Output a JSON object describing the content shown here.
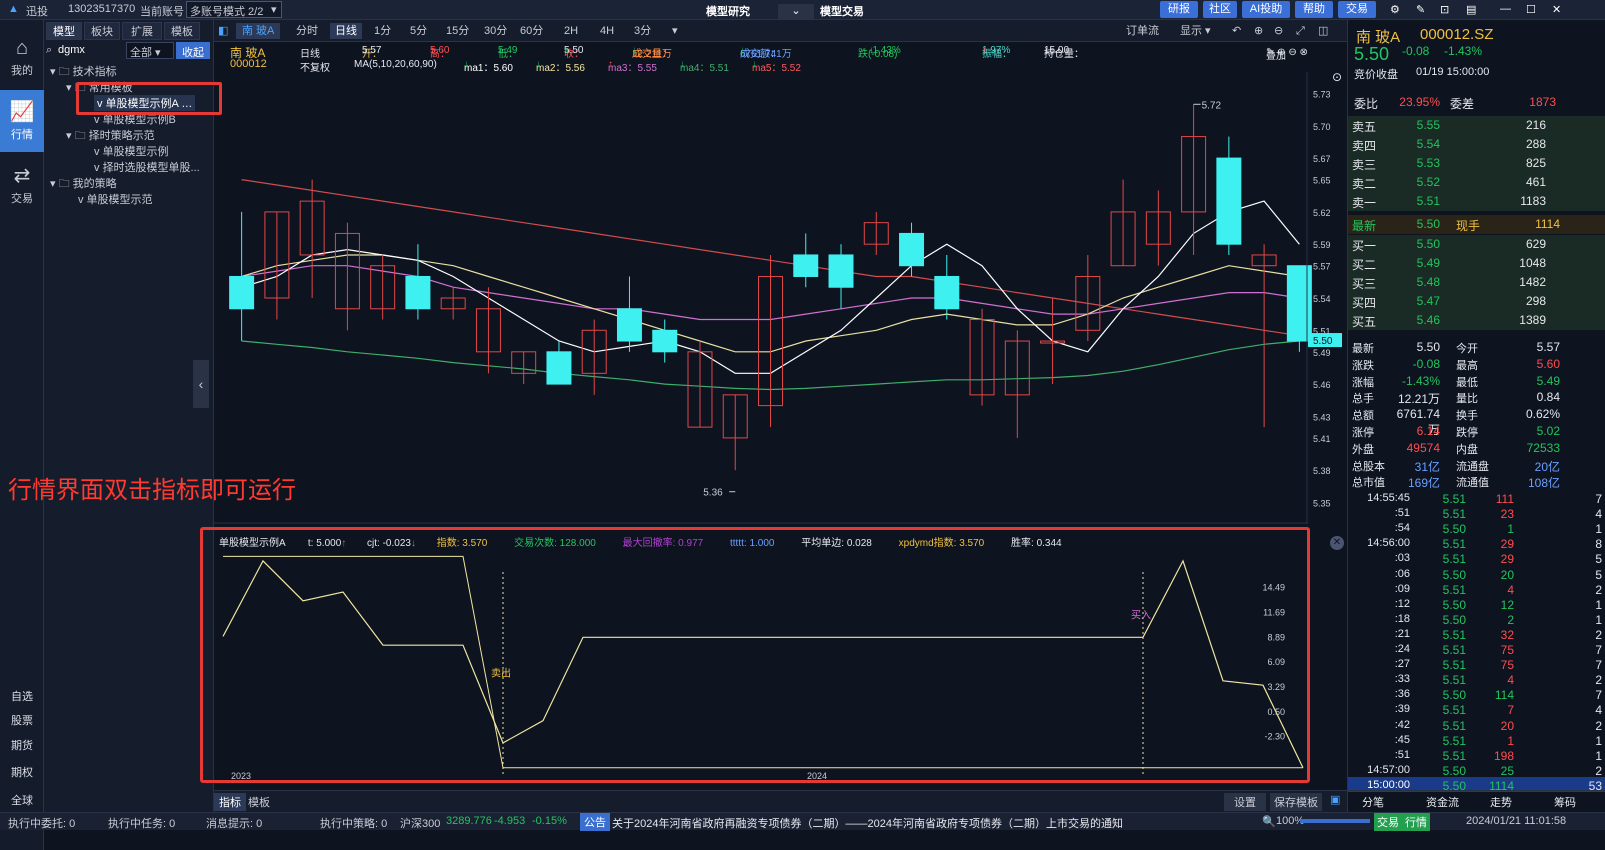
{
  "titlebar": {
    "app": "迅投",
    "account": "13023517370",
    "current_account_label": "当前账号",
    "mode": "多账号模式 2/2",
    "center_left": "模型研究",
    "center_right": "模型交易",
    "buttons": [
      "研报",
      "社区",
      "AI投助",
      "帮助",
      "交易"
    ]
  },
  "leftnav": {
    "items": [
      "我的",
      "行情",
      "交易"
    ],
    "bottom": [
      "自选",
      "股票",
      "期货",
      "期权",
      "全球"
    ]
  },
  "tree": {
    "tabs": [
      "模型",
      "板块",
      "扩展",
      "模板"
    ],
    "search": "dgmx",
    "filter": "全部",
    "collapse": "收起",
    "nodes": [
      "技术指标",
      "常用模板",
      "单股模型示例A",
      "单股模型示例B",
      "择时策略示范",
      "单股模型示例",
      "择时选股模型单股...",
      "我的策略",
      "单股模型示范"
    ]
  },
  "chartbar": {
    "stock": "南 玻A",
    "periods": [
      "分时",
      "日线",
      "1分",
      "5分",
      "15分",
      "30分",
      "60分",
      "2H",
      "4H",
      "3分"
    ],
    "active_period": "日线",
    "order": "订单流",
    "show": "显示"
  },
  "info": {
    "name": "南 玻A",
    "code": "000012",
    "period": "日线",
    "adjust": "不复权",
    "open_l": "开：",
    "open": "5.57",
    "high_l": "高：",
    "high": "5.60",
    "low_l": "低：",
    "low": "5.49",
    "close_l": "收：",
    "close": "5.50",
    "vol_l": "成交量：",
    "vol": "12.211万",
    "amt_l": "成交额：",
    "amt": "6761.741万",
    "chg_l": "跌(-0.08)",
    "chg": "-1.43%",
    "amp_l": "振幅：",
    "amp": "1.97%",
    "oi_l": "持仓量：",
    "oi": "15.00",
    "ma": "MA(5,10,20,60,90)",
    "ma1": "ma1：5.60",
    "ma2": "ma2：5.56",
    "ma3": "ma3：5.55",
    "ma4": "ma4：5.51",
    "ma5": "ma5：5.52",
    "overlay": "叠加"
  },
  "overlay_text": "行情界面双击指标即可运行",
  "chart_data": [
    {
      "type": "candlestick",
      "yticks": [
        "5.73",
        "5.70",
        "5.67",
        "5.65",
        "5.62",
        "5.59",
        "5.57",
        "5.54",
        "5.51",
        "5.49",
        "5.46",
        "5.43",
        "5.41",
        "5.38",
        "5.35"
      ],
      "ylim": [
        5.33,
        5.75
      ],
      "max_label": "5.72",
      "min_label": "5.36",
      "last_label": "5.50",
      "candles": [
        [
          5.56,
          5.53,
          5.62,
          5.5
        ],
        [
          5.54,
          5.62,
          5.62,
          5.52
        ],
        [
          5.58,
          5.63,
          5.65,
          5.54
        ],
        [
          5.53,
          5.6,
          5.61,
          5.51
        ],
        [
          5.53,
          5.57,
          5.58,
          5.52
        ],
        [
          5.56,
          5.53,
          5.59,
          5.52
        ],
        [
          5.53,
          5.54,
          5.55,
          5.52
        ],
        [
          5.49,
          5.53,
          5.55,
          5.47
        ],
        [
          5.47,
          5.49,
          5.49,
          5.46
        ],
        [
          5.49,
          5.46,
          5.5,
          5.46
        ],
        [
          5.47,
          5.51,
          5.52,
          5.45
        ],
        [
          5.53,
          5.5,
          5.56,
          5.49
        ],
        [
          5.51,
          5.49,
          5.52,
          5.48
        ],
        [
          5.42,
          5.49,
          5.5,
          5.42
        ],
        [
          5.41,
          5.45,
          5.45,
          5.38
        ],
        [
          5.44,
          5.56,
          5.58,
          5.42
        ],
        [
          5.58,
          5.56,
          5.6,
          5.55
        ],
        [
          5.58,
          5.55,
          5.59,
          5.53
        ],
        [
          5.59,
          5.61,
          5.62,
          5.58
        ],
        [
          5.6,
          5.57,
          5.61,
          5.56
        ],
        [
          5.56,
          5.53,
          5.58,
          5.52
        ],
        [
          5.45,
          5.52,
          5.53,
          5.44
        ],
        [
          5.45,
          5.5,
          5.51,
          5.41
        ],
        [
          5.5,
          5.5,
          5.54,
          5.46
        ],
        [
          5.51,
          5.56,
          5.58,
          5.5
        ],
        [
          5.57,
          5.62,
          5.65,
          5.57
        ],
        [
          5.59,
          5.62,
          5.64,
          5.57
        ],
        [
          5.62,
          5.69,
          5.72,
          5.58
        ],
        [
          5.67,
          5.59,
          5.69,
          5.58
        ],
        [
          5.57,
          5.58,
          5.59,
          5.42
        ],
        [
          5.57,
          5.5,
          5.57,
          5.49
        ]
      ],
      "ma_series": [
        {
          "color": "#d24c4c",
          "values": [
            5.65,
            5.645,
            5.64,
            5.635,
            5.63,
            5.625,
            5.62,
            5.615,
            5.61,
            5.605,
            5.6,
            5.595,
            5.59,
            5.585,
            5.58,
            5.575,
            5.57,
            5.565,
            5.56,
            5.56,
            5.555,
            5.55,
            5.545,
            5.54,
            5.535,
            5.53,
            5.525,
            5.52,
            5.515,
            5.51,
            5.505
          ]
        },
        {
          "color": "#d070d0",
          "values": [
            5.56,
            5.565,
            5.57,
            5.57,
            5.565,
            5.56,
            5.55,
            5.545,
            5.54,
            5.535,
            5.53,
            5.53,
            5.525,
            5.52,
            5.52,
            5.52,
            5.525,
            5.53,
            5.535,
            5.54,
            5.54,
            5.535,
            5.53,
            5.525,
            5.525,
            5.53,
            5.535,
            5.54,
            5.545,
            5.545,
            5.54
          ]
        },
        {
          "color": "#e8e0a0",
          "values": [
            5.56,
            5.57,
            5.575,
            5.58,
            5.58,
            5.575,
            5.57,
            5.56,
            5.55,
            5.54,
            5.53,
            5.52,
            5.51,
            5.5,
            5.49,
            5.49,
            5.5,
            5.505,
            5.51,
            5.52,
            5.525,
            5.52,
            5.515,
            5.515,
            5.525,
            5.54,
            5.55,
            5.56,
            5.57,
            5.565,
            5.56
          ]
        },
        {
          "color": "#3fae6a",
          "values": [
            5.5,
            5.497,
            5.494,
            5.49,
            5.487,
            5.484,
            5.48,
            5.477,
            5.474,
            5.47,
            5.467,
            5.464,
            5.46,
            5.458,
            5.456,
            5.455,
            5.456,
            5.458,
            5.46,
            5.462,
            5.464,
            5.464,
            5.465,
            5.466,
            5.468,
            5.472,
            5.478,
            5.485,
            5.492,
            5.497,
            5.5
          ]
        },
        {
          "color": "#ffffff",
          "values": [
            5.55,
            5.56,
            5.58,
            5.585,
            5.58,
            5.575,
            5.56,
            5.54,
            5.52,
            5.5,
            5.49,
            5.495,
            5.5,
            5.49,
            5.47,
            5.47,
            5.49,
            5.51,
            5.54,
            5.57,
            5.59,
            5.57,
            5.53,
            5.5,
            5.49,
            5.53,
            5.56,
            5.6,
            5.62,
            5.63,
            5.59
          ]
        }
      ]
    },
    {
      "type": "line",
      "title": "单股模型示例A",
      "yticks": [
        "14.49",
        "11.69",
        "8.89",
        "6.09",
        "3.29",
        "0.50",
        "-2.30"
      ],
      "ylim": [
        -6.5,
        18.5
      ],
      "x_labels": [
        "2023",
        "2024"
      ],
      "annotations": [
        "卖出",
        "买入"
      ],
      "values": [
        9,
        17.5,
        13,
        14,
        8,
        8,
        8,
        -3,
        -0.5,
        8.89,
        8.89,
        8.89,
        8.89,
        8.89,
        8.89,
        8.89,
        8.89,
        8.89,
        8.89,
        8.89,
        8.89,
        8.89,
        8.89,
        8.89,
        17.5,
        4,
        3.5,
        -5.8
      ],
      "flat": [
        18,
        18,
        18,
        18,
        18,
        18,
        18,
        -5.8,
        -5.8,
        -5.8,
        -5.8,
        -5.8,
        -5.8,
        -5.8,
        -5.8,
        -5.8,
        -5.8,
        -5.8,
        -5.8,
        -5.8,
        -5.8,
        -5.8,
        -5.8,
        -5.8,
        -5.8,
        -5.8,
        -5.8,
        -5.8
      ]
    }
  ],
  "subinfo": {
    "name": "单股模型示例A",
    "t": "t: 5.000",
    "cjt": "cjt: -0.023",
    "idx": "指数: 3.570",
    "trades": "交易次数: 128.000",
    "dd": "最大回撤率: 0.977",
    "ttt": "ttttt: 1.000",
    "avg": "平均单边: 0.028",
    "xp": "xpdymd指数: 3.570",
    "win": "胜率: 0.344"
  },
  "footbar": {
    "tabs": [
      "指标",
      "模板"
    ],
    "settings": "设置",
    "save": "保存模板"
  },
  "statusbar": [
    "执行中委托: 0",
    "执行中任务: 0",
    "消息提示: 0",
    "执行中策略: 0",
    "沪深300",
    "3289.776",
    "-4.953",
    "-0.15%",
    "公告",
    "关于2024年河南省政府再融资专项债券（二期）——2024年河南省政府专项债券（二期）上市交易的通知",
    "100%",
    "交易",
    "行情",
    "2024/01/21 11:01:58"
  ],
  "right": {
    "name": "南 玻A",
    "code": "000012.SZ",
    "price": "5.50",
    "chg": "-0.08",
    "pct": "-1.43%",
    "auction": "竞价收盘",
    "time": "01/19  15:00:00",
    "wb": [
      "委比",
      "23.95%",
      "委差",
      "1873"
    ],
    "asks": [
      [
        "卖五",
        "5.55",
        "216"
      ],
      [
        "卖四",
        "5.54",
        "288"
      ],
      [
        "卖三",
        "5.53",
        "825"
      ],
      [
        "卖二",
        "5.52",
        "461"
      ],
      [
        "卖一",
        "5.51",
        "1183"
      ]
    ],
    "latest": [
      "最新",
      "5.50",
      "现手",
      "1114"
    ],
    "bids": [
      [
        "买一",
        "5.50",
        "629"
      ],
      [
        "买二",
        "5.49",
        "1048"
      ],
      [
        "买三",
        "5.48",
        "1482"
      ],
      [
        "买四",
        "5.47",
        "298"
      ],
      [
        "买五",
        "5.46",
        "1389"
      ]
    ],
    "stats": [
      [
        "最新",
        "5.50",
        "今开",
        "5.57"
      ],
      [
        "涨跌",
        "-0.08",
        "最高",
        "5.60"
      ],
      [
        "涨幅",
        "-1.43%",
        "最低",
        "5.49"
      ],
      [
        "总手",
        "12.21万",
        "量比",
        "0.84"
      ],
      [
        "总额",
        "6761.74万",
        "换手",
        "0.62%"
      ],
      [
        "涨停",
        "6.14",
        "跌停",
        "5.02"
      ],
      [
        "外盘",
        "49574",
        "内盘",
        "72533"
      ],
      [
        "总股本",
        "31亿",
        "流通盘",
        "20亿"
      ],
      [
        "总市值",
        "169亿",
        "流通值",
        "108亿"
      ]
    ],
    "ticks": [
      [
        "14:55:45",
        "5.51",
        "111",
        "7"
      ],
      [
        ":51",
        "5.51",
        "23",
        "4"
      ],
      [
        ":54",
        "5.50",
        "1",
        "1"
      ],
      [
        "14:56:00",
        "5.51",
        "29",
        "8"
      ],
      [
        ":03",
        "5.51",
        "29",
        "5"
      ],
      [
        ":06",
        "5.50",
        "20",
        "5"
      ],
      [
        ":09",
        "5.51",
        "4",
        "2"
      ],
      [
        ":12",
        "5.50",
        "12",
        "1"
      ],
      [
        ":18",
        "5.50",
        "2",
        "1"
      ],
      [
        ":21",
        "5.51",
        "32",
        "2"
      ],
      [
        ":24",
        "5.51",
        "75",
        "7"
      ],
      [
        ":27",
        "5.51",
        "75",
        "7"
      ],
      [
        ":33",
        "5.51",
        "4",
        "2"
      ],
      [
        ":36",
        "5.50",
        "114",
        "7"
      ],
      [
        ":39",
        "5.51",
        "7",
        "4"
      ],
      [
        ":42",
        "5.51",
        "20",
        "2"
      ],
      [
        ":45",
        "5.51",
        "1",
        "1"
      ],
      [
        ":51",
        "5.51",
        "198",
        "1"
      ],
      [
        "14:57:00",
        "5.50",
        "25",
        "2"
      ],
      [
        "15:00:00",
        "5.50",
        "1114",
        "53"
      ]
    ],
    "tabs": [
      "分笔",
      "资金流",
      "走势",
      "筹码"
    ]
  }
}
